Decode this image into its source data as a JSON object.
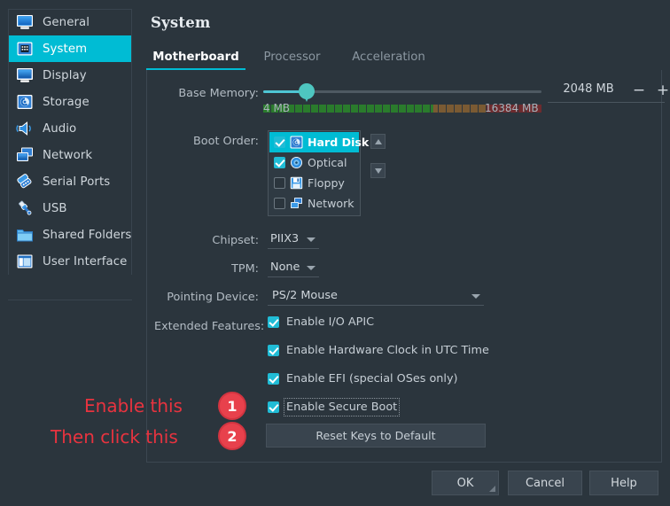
{
  "window": {
    "title": "System"
  },
  "sidebar": {
    "items": [
      {
        "label": "General",
        "icon": "monitor-icon",
        "selected": false
      },
      {
        "label": "System",
        "icon": "system-chip-icon",
        "selected": true
      },
      {
        "label": "Display",
        "icon": "display-icon",
        "selected": false
      },
      {
        "label": "Storage",
        "icon": "storage-disk-icon",
        "selected": false
      },
      {
        "label": "Audio",
        "icon": "speaker-icon",
        "selected": false
      },
      {
        "label": "Network",
        "icon": "network-icon",
        "selected": false
      },
      {
        "label": "Serial Ports",
        "icon": "serial-port-icon",
        "selected": false
      },
      {
        "label": "USB",
        "icon": "usb-icon",
        "selected": false
      },
      {
        "label": "Shared Folders",
        "icon": "folder-icon",
        "selected": false
      },
      {
        "label": "User Interface",
        "icon": "user-interface-icon",
        "selected": false
      }
    ]
  },
  "tabs": [
    {
      "label": "Motherboard",
      "active": true
    },
    {
      "label": "Processor",
      "active": false
    },
    {
      "label": "Acceleration",
      "active": false
    }
  ],
  "motherboard": {
    "base_memory": {
      "label": "Base Memory:",
      "value": "2048 MB",
      "min_label": "4 MB",
      "max_label": "16384 MB",
      "minus_label": "−",
      "plus_label": "+"
    },
    "boot_order": {
      "label": "Boot Order:",
      "items": [
        {
          "label": "Hard Disk",
          "checked": true,
          "selected": true,
          "icon": "hard-disk-icon"
        },
        {
          "label": "Optical",
          "checked": true,
          "selected": false,
          "icon": "optical-disc-icon"
        },
        {
          "label": "Floppy",
          "checked": false,
          "selected": false,
          "icon": "floppy-icon"
        },
        {
          "label": "Network",
          "checked": false,
          "selected": false,
          "icon": "network-boot-icon"
        }
      ],
      "move_up": "move-up",
      "move_down": "move-down"
    },
    "chipset": {
      "label": "Chipset:",
      "value": "PIIX3"
    },
    "tpm": {
      "label": "TPM:",
      "value": "None"
    },
    "pointing": {
      "label": "Pointing Device:",
      "value": "PS/2 Mouse"
    },
    "extended_features": {
      "label": "Extended Features:",
      "items": [
        {
          "label": "Enable I/O APIC",
          "checked": true,
          "focused": false
        },
        {
          "label": "Enable Hardware Clock in UTC Time",
          "checked": true,
          "focused": false
        },
        {
          "label": "Enable EFI (special OSes only)",
          "checked": true,
          "focused": false
        },
        {
          "label": "Enable Secure Boot",
          "checked": true,
          "focused": true
        }
      ]
    },
    "reset_keys_button": "Reset Keys to Default"
  },
  "annotations": [
    {
      "text": "Enable this",
      "badge": "1"
    },
    {
      "text": "Then click this",
      "badge": "2"
    }
  ],
  "dialog_buttons": {
    "ok": "OK",
    "cancel": "Cancel",
    "help": "Help"
  },
  "colors": {
    "accent": "#00bcd4",
    "checkbox": "#20bcd6",
    "annotation": "#e8333f",
    "background": "#2b353d",
    "panel_border": "#3c4751",
    "text": "#cfd6dc",
    "muted_text": "#8b97a1",
    "slider_handle": "#4ec6c0",
    "bar_green": "#2a7b2c",
    "bar_brown": "#7a5a33",
    "bar_red": "#6e2b2e"
  }
}
